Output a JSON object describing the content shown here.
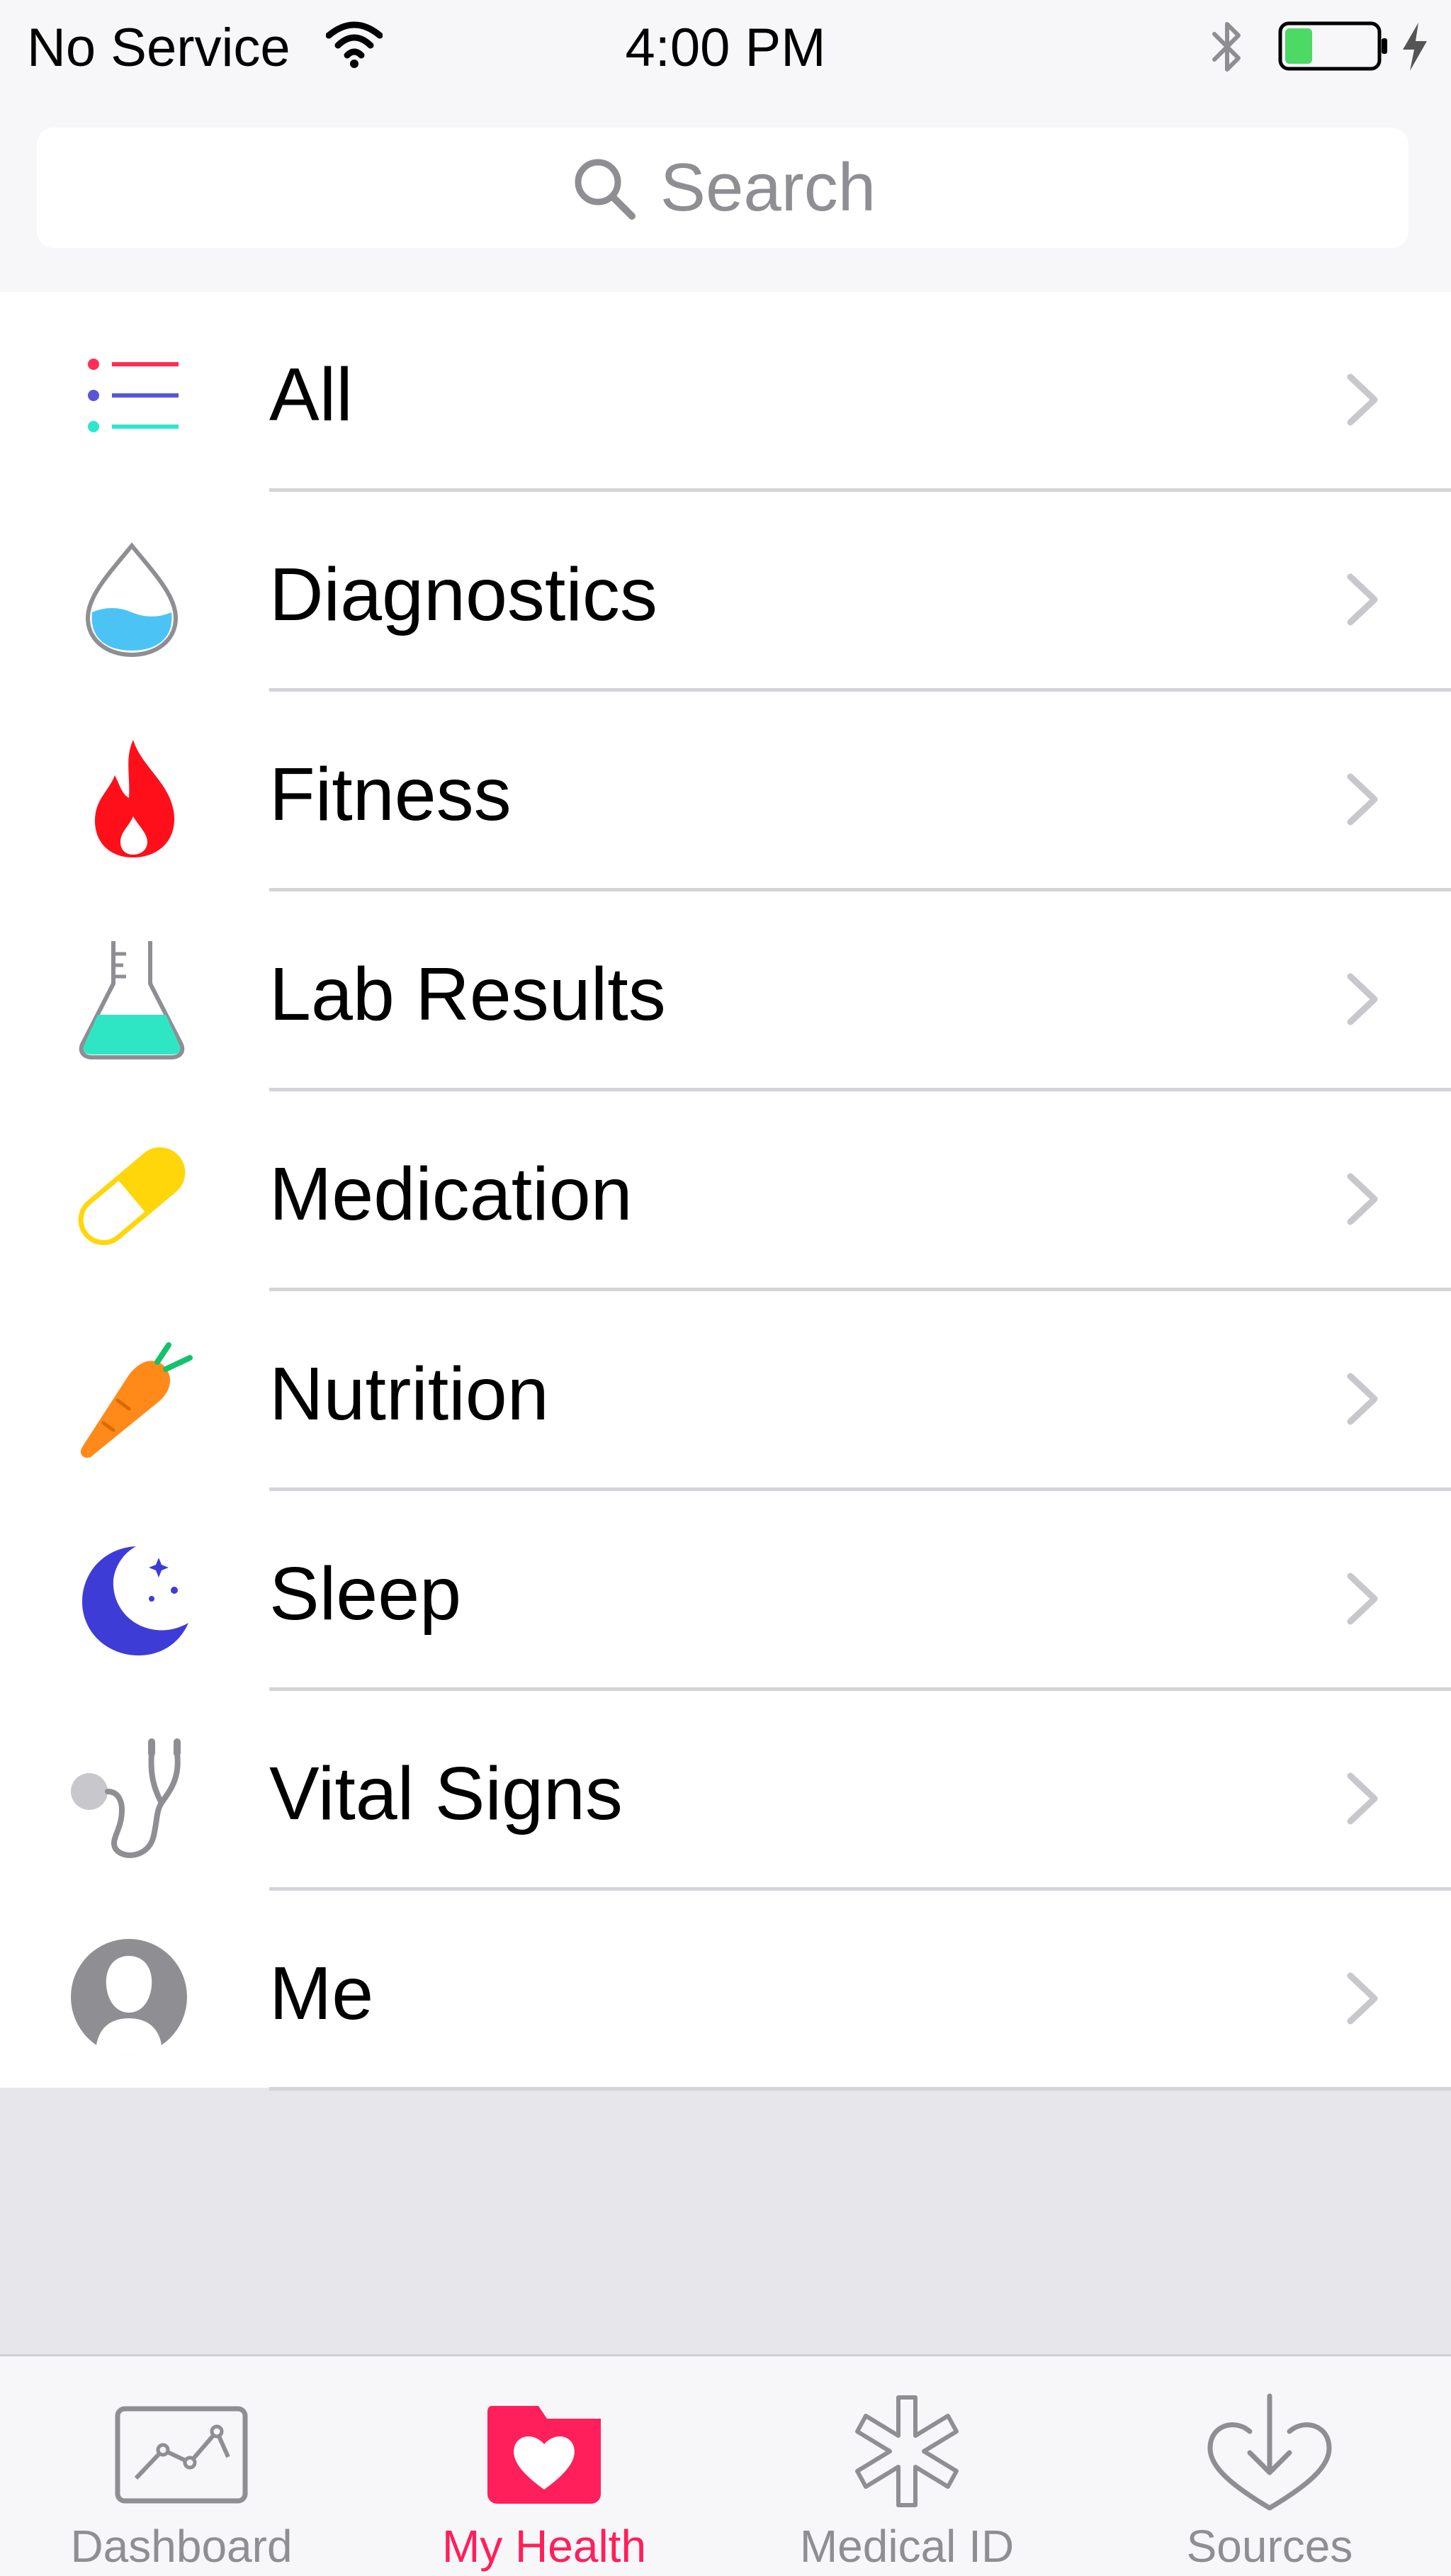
{
  "status_bar": {
    "carrier": "No Service",
    "time": "4:00 PM",
    "battery_level": 0.3,
    "battery_color": "#4cd964",
    "icons": [
      "wifi-icon",
      "bluetooth-icon",
      "battery-icon",
      "charging-bolt-icon"
    ]
  },
  "search": {
    "placeholder": "Search",
    "icon": "search-icon"
  },
  "categories": [
    {
      "label": "All",
      "icon": "list-icon"
    },
    {
      "label": "Diagnostics",
      "icon": "water-drop-icon"
    },
    {
      "label": "Fitness",
      "icon": "flame-icon"
    },
    {
      "label": "Lab Results",
      "icon": "flask-icon"
    },
    {
      "label": "Medication",
      "icon": "pill-icon"
    },
    {
      "label": "Nutrition",
      "icon": "carrot-icon"
    },
    {
      "label": "Sleep",
      "icon": "moon-icon"
    },
    {
      "label": "Vital Signs",
      "icon": "stethoscope-icon"
    },
    {
      "label": "Me",
      "icon": "person-icon"
    }
  ],
  "tab_bar": {
    "active_color": "#ff1f5a",
    "inactive_color": "#8e8e93",
    "tabs": [
      {
        "label": "Dashboard",
        "icon": "dashboard-icon",
        "active": false
      },
      {
        "label": "My Health",
        "icon": "health-folder-icon",
        "active": true
      },
      {
        "label": "Medical ID",
        "icon": "medical-asterisk-icon",
        "active": false
      },
      {
        "label": "Sources",
        "icon": "sources-download-icon",
        "active": false
      }
    ]
  }
}
